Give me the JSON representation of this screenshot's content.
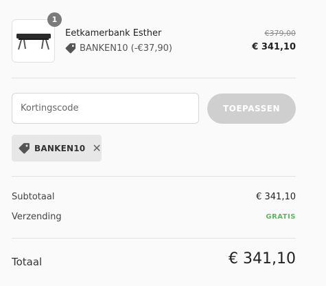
{
  "product": {
    "quantity": "1",
    "name": "Eetkamerbank Esther",
    "discount_line": "BANKEN10 (-€37,90)",
    "old_price": "€379,00",
    "price": "€ 341,10",
    "image_icon": "bench-icon",
    "discount_icon": "tag-icon"
  },
  "discount_code": {
    "placeholder": "Kortingscode",
    "value": "",
    "apply_label": "TOEPASSEN",
    "applied_code": "BANKEN10",
    "remove_icon": "close-icon"
  },
  "summary": {
    "subtotal_label": "Subtotaal",
    "subtotal_value": "€ 341,10",
    "shipping_label": "Verzending",
    "shipping_value": "GRATIS",
    "total_label": "Totaal",
    "total_value": "€ 341,10"
  },
  "colors": {
    "free_shipping": "#5cb85c",
    "apply_button_disabled": "#cfcfcf",
    "chip_background": "#e7e7e7",
    "quantity_badge": "#7b7b7b"
  }
}
